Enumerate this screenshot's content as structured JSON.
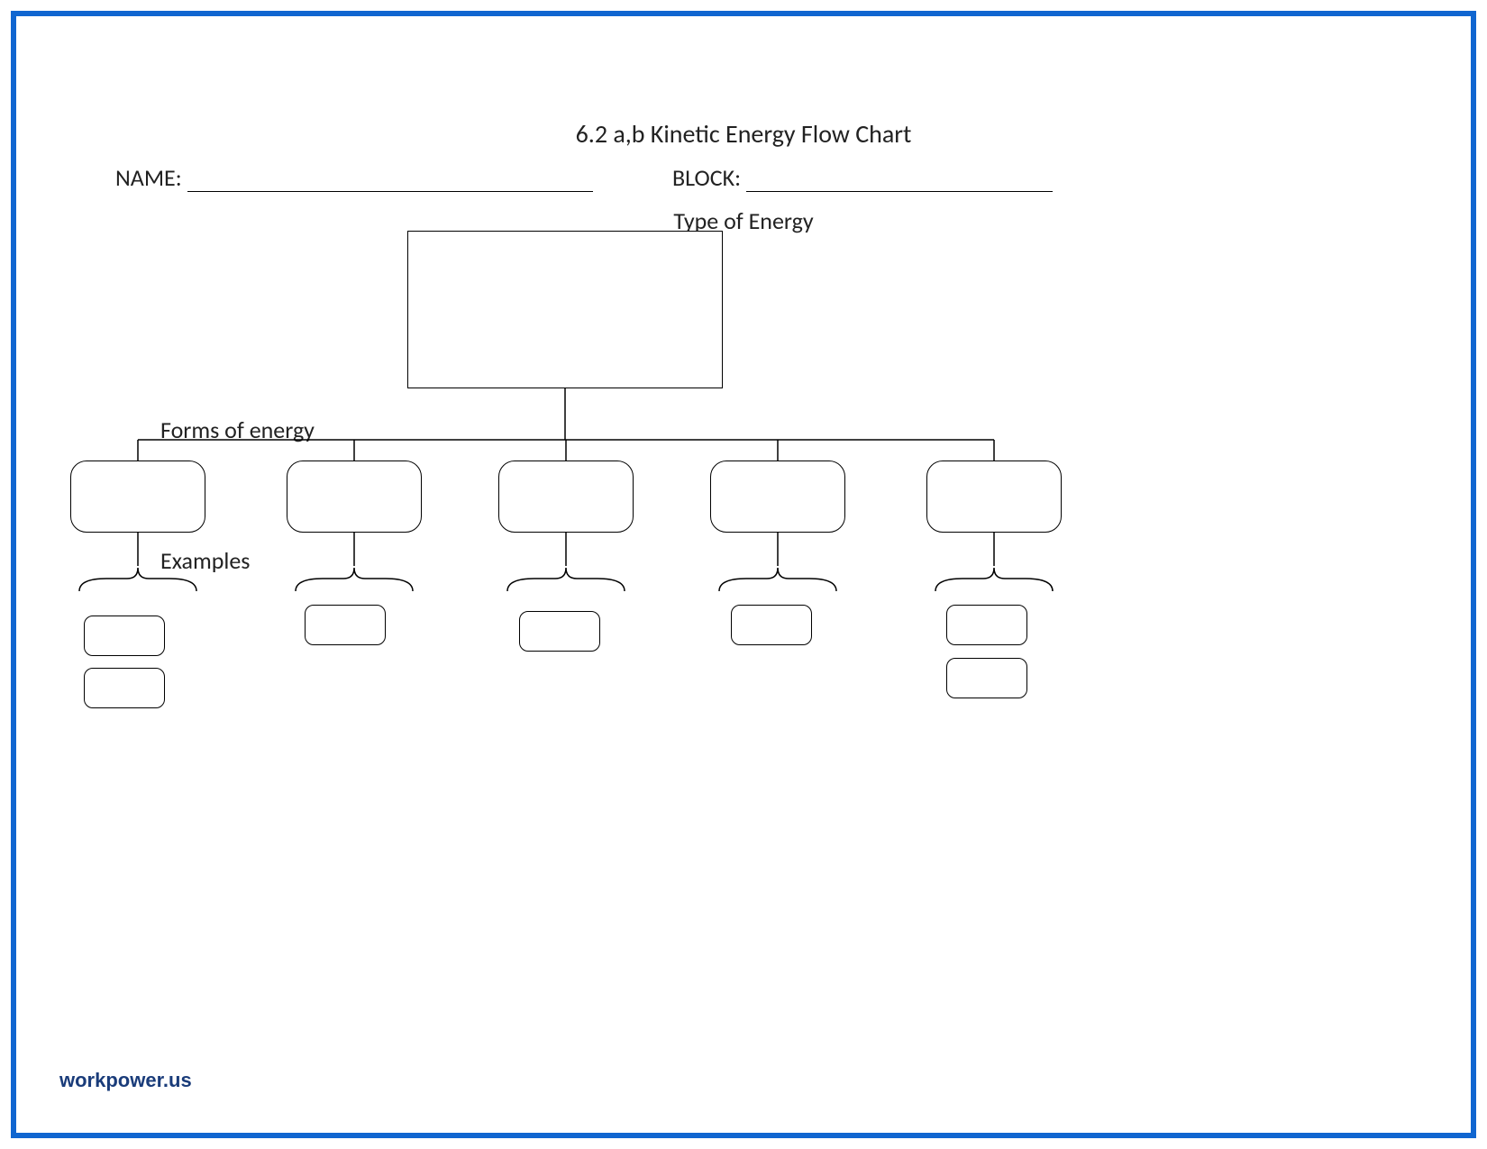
{
  "title": "6.2 a,b Kinetic Energy Flow Chart",
  "fields": {
    "name_label": "NAME:",
    "block_label": "BLOCK:"
  },
  "labels": {
    "type": "Type of Energy",
    "forms": "Forms of energy",
    "examples": "Examples"
  },
  "watermark": "workpower.us"
}
